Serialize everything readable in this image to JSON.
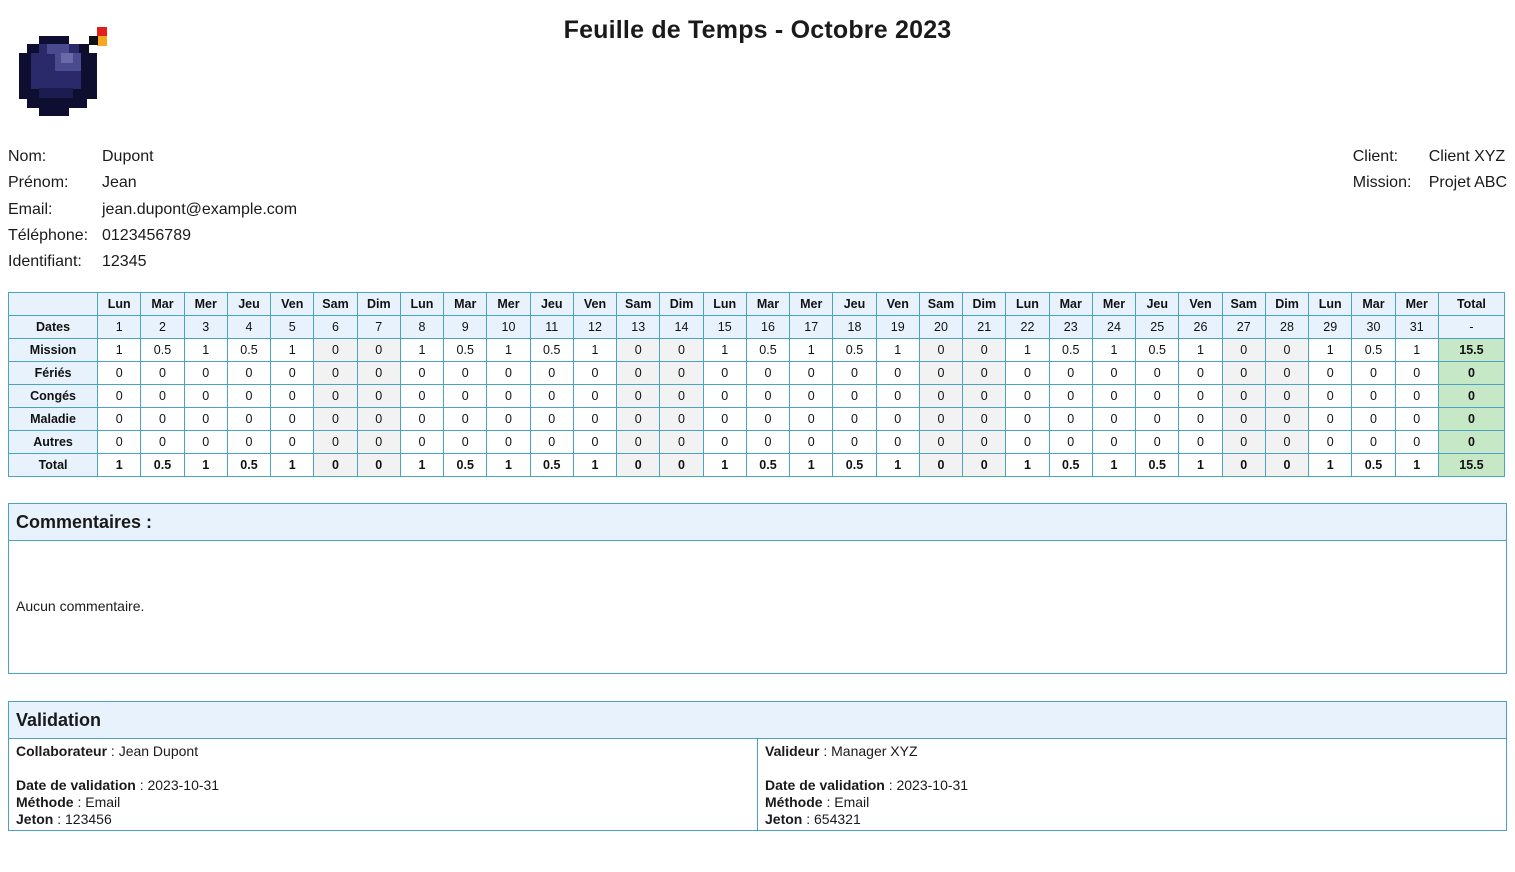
{
  "title": "Feuille de Temps - Octobre 2023",
  "logo_icon": "bomb-pixel-icon",
  "employee": [
    {
      "label": "Nom:",
      "value": "Dupont"
    },
    {
      "label": "Prénom:",
      "value": "Jean"
    },
    {
      "label": "Email:",
      "value": "jean.dupont@example.com"
    },
    {
      "label": "Téléphone:",
      "value": "0123456789"
    },
    {
      "label": "Identifiant:",
      "value": "12345"
    }
  ],
  "client": [
    {
      "label": "Client:",
      "value": "Client XYZ"
    },
    {
      "label": "Mission:",
      "value": "Projet ABC"
    }
  ],
  "timesheet": {
    "days": [
      "Lun",
      "Mar",
      "Mer",
      "Jeu",
      "Ven",
      "Sam",
      "Dim",
      "Lun",
      "Mar",
      "Mer",
      "Jeu",
      "Ven",
      "Sam",
      "Dim",
      "Lun",
      "Mar",
      "Mer",
      "Jeu",
      "Ven",
      "Sam",
      "Dim",
      "Lun",
      "Mar",
      "Mer",
      "Jeu",
      "Ven",
      "Sam",
      "Dim",
      "Lun",
      "Mar",
      "Mer"
    ],
    "total_header": "Total",
    "dates_label": "Dates",
    "dates": [
      "1",
      "2",
      "3",
      "4",
      "5",
      "6",
      "7",
      "8",
      "9",
      "10",
      "11",
      "12",
      "13",
      "14",
      "15",
      "16",
      "17",
      "18",
      "19",
      "20",
      "21",
      "22",
      "23",
      "24",
      "25",
      "26",
      "27",
      "28",
      "29",
      "30",
      "31"
    ],
    "dates_total": "-",
    "rows": [
      {
        "label": "Mission",
        "values": [
          "1",
          "0.5",
          "1",
          "0.5",
          "1",
          "0",
          "0",
          "1",
          "0.5",
          "1",
          "0.5",
          "1",
          "0",
          "0",
          "1",
          "0.5",
          "1",
          "0.5",
          "1",
          "0",
          "0",
          "1",
          "0.5",
          "1",
          "0.5",
          "1",
          "0",
          "0",
          "1",
          "0.5",
          "1"
        ],
        "total": "15.5"
      },
      {
        "label": "Fériés",
        "values": [
          "0",
          "0",
          "0",
          "0",
          "0",
          "0",
          "0",
          "0",
          "0",
          "0",
          "0",
          "0",
          "0",
          "0",
          "0",
          "0",
          "0",
          "0",
          "0",
          "0",
          "0",
          "0",
          "0",
          "0",
          "0",
          "0",
          "0",
          "0",
          "0",
          "0",
          "0"
        ],
        "total": "0"
      },
      {
        "label": "Congés",
        "values": [
          "0",
          "0",
          "0",
          "0",
          "0",
          "0",
          "0",
          "0",
          "0",
          "0",
          "0",
          "0",
          "0",
          "0",
          "0",
          "0",
          "0",
          "0",
          "0",
          "0",
          "0",
          "0",
          "0",
          "0",
          "0",
          "0",
          "0",
          "0",
          "0",
          "0",
          "0"
        ],
        "total": "0"
      },
      {
        "label": "Maladie",
        "values": [
          "0",
          "0",
          "0",
          "0",
          "0",
          "0",
          "0",
          "0",
          "0",
          "0",
          "0",
          "0",
          "0",
          "0",
          "0",
          "0",
          "0",
          "0",
          "0",
          "0",
          "0",
          "0",
          "0",
          "0",
          "0",
          "0",
          "0",
          "0",
          "0",
          "0",
          "0"
        ],
        "total": "0"
      },
      {
        "label": "Autres",
        "values": [
          "0",
          "0",
          "0",
          "0",
          "0",
          "0",
          "0",
          "0",
          "0",
          "0",
          "0",
          "0",
          "0",
          "0",
          "0",
          "0",
          "0",
          "0",
          "0",
          "0",
          "0",
          "0",
          "0",
          "0",
          "0",
          "0",
          "0",
          "0",
          "0",
          "0",
          "0"
        ],
        "total": "0"
      }
    ],
    "total_row": {
      "label": "Total",
      "values": [
        "1",
        "0.5",
        "1",
        "0.5",
        "1",
        "0",
        "0",
        "1",
        "0.5",
        "1",
        "0.5",
        "1",
        "0",
        "0",
        "1",
        "0.5",
        "1",
        "0.5",
        "1",
        "0",
        "0",
        "1",
        "0.5",
        "1",
        "0.5",
        "1",
        "0",
        "0",
        "1",
        "0.5",
        "1"
      ],
      "total": "15.5"
    }
  },
  "comments": {
    "heading": "Commentaires :",
    "text": "Aucun commentaire."
  },
  "validation": {
    "heading": "Validation",
    "left": {
      "role_label": "Collaborateur",
      "role_value": "Jean Dupont",
      "date_label": "Date de validation",
      "date_value": "2023-10-31",
      "method_label": "Méthode",
      "method_value": "Email",
      "token_label": "Jeton",
      "token_value": "123456"
    },
    "right": {
      "role_label": "Valideur",
      "role_value": "Manager XYZ",
      "date_label": "Date de validation",
      "date_value": "2023-10-31",
      "method_label": "Méthode",
      "method_value": "Email",
      "token_label": "Jeton",
      "token_value": "654321"
    }
  }
}
